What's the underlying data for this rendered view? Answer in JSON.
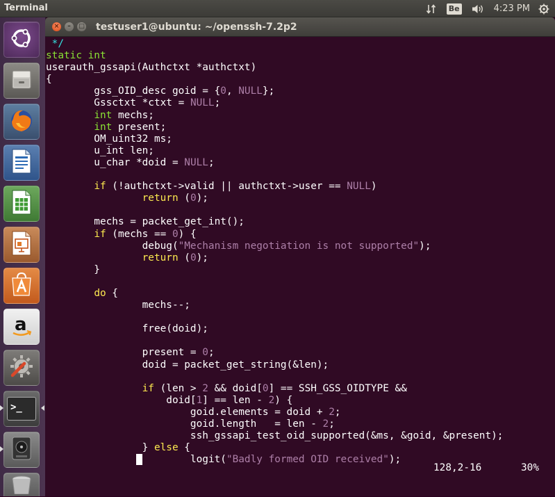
{
  "topbar": {
    "app_title": "Terminal",
    "keyboard_layout": "Be",
    "clock": "4:23 PM",
    "icons": [
      "network-arrows-icon",
      "keyboard-layout-icon",
      "volume-icon",
      "power-gear-icon"
    ]
  },
  "launcher": {
    "items": [
      {
        "name": "ubuntu-dash",
        "icon": "ubuntu-logo-icon"
      },
      {
        "name": "files",
        "icon": "file-cabinet-icon"
      },
      {
        "name": "firefox",
        "icon": "firefox-icon"
      },
      {
        "name": "libreoffice-writer",
        "icon": "writer-document-icon"
      },
      {
        "name": "libreoffice-calc",
        "icon": "calc-spreadsheet-icon"
      },
      {
        "name": "libreoffice-impress",
        "icon": "impress-presentation-icon"
      },
      {
        "name": "ubuntu-software",
        "icon": "software-bag-icon"
      },
      {
        "name": "amazon",
        "icon": "amazon-icon"
      },
      {
        "name": "system-settings",
        "icon": "wrench-gear-icon"
      },
      {
        "name": "terminal",
        "icon": "terminal-prompt-icon",
        "active": true,
        "prompt": ">_"
      },
      {
        "name": "installer-disk",
        "icon": "disk-icon"
      },
      {
        "name": "trash",
        "icon": "trash-icon"
      }
    ]
  },
  "window": {
    "title": "testuser1@ubuntu: ~/openssh-7.2p2",
    "close_glyph": "×",
    "min_glyph": "–",
    "max_glyph": "□"
  },
  "terminal": {
    "colors": {
      "background": "#300a24",
      "comment": "#34e2e2",
      "type": "#8ae234",
      "keyword": "#fce94f",
      "constant": "#ad7fa8",
      "text": "#ffffff"
    },
    "lines": [
      [
        [
          " */",
          "cmt"
        ]
      ],
      [
        [
          "static int",
          "typ"
        ]
      ],
      [
        [
          "userauth_gssapi(Authctxt *authctxt)",
          "id"
        ]
      ],
      [
        [
          "{",
          "plain"
        ]
      ],
      [
        [
          "        gss_OID_desc goid = {",
          "plain"
        ],
        [
          "0",
          "num"
        ],
        [
          ", ",
          "plain"
        ],
        [
          "NULL",
          "num"
        ],
        [
          "};",
          "plain"
        ]
      ],
      [
        [
          "        Gssctxt *ctxt = ",
          "plain"
        ],
        [
          "NULL",
          "num"
        ],
        [
          ";",
          "plain"
        ]
      ],
      [
        [
          "        ",
          "plain"
        ],
        [
          "int",
          "typ"
        ],
        [
          " mechs;",
          "plain"
        ]
      ],
      [
        [
          "        ",
          "plain"
        ],
        [
          "int",
          "typ"
        ],
        [
          " present;",
          "plain"
        ]
      ],
      [
        [
          "        OM_uint32 ms;",
          "plain"
        ]
      ],
      [
        [
          "        u_int len;",
          "plain"
        ]
      ],
      [
        [
          "        u_char *doid = ",
          "plain"
        ],
        [
          "NULL",
          "num"
        ],
        [
          ";",
          "plain"
        ]
      ],
      [
        [
          "",
          "plain"
        ]
      ],
      [
        [
          "        ",
          "plain"
        ],
        [
          "if",
          "kw"
        ],
        [
          " (!authctxt->valid || authctxt->user == ",
          "plain"
        ],
        [
          "NULL",
          "num"
        ],
        [
          ")",
          "plain"
        ]
      ],
      [
        [
          "                ",
          "plain"
        ],
        [
          "return",
          "kw"
        ],
        [
          " (",
          "plain"
        ],
        [
          "0",
          "num"
        ],
        [
          ");",
          "plain"
        ]
      ],
      [
        [
          "",
          "plain"
        ]
      ],
      [
        [
          "        mechs = packet_get_int();",
          "plain"
        ]
      ],
      [
        [
          "        ",
          "plain"
        ],
        [
          "if",
          "kw"
        ],
        [
          " (mechs == ",
          "plain"
        ],
        [
          "0",
          "num"
        ],
        [
          ") {",
          "plain"
        ]
      ],
      [
        [
          "                debug(",
          "plain"
        ],
        [
          "\"Mechanism negotiation is not supported\"",
          "str"
        ],
        [
          ");",
          "plain"
        ]
      ],
      [
        [
          "                ",
          "plain"
        ],
        [
          "return",
          "kw"
        ],
        [
          " (",
          "plain"
        ],
        [
          "0",
          "num"
        ],
        [
          ");",
          "plain"
        ]
      ],
      [
        [
          "        }",
          "plain"
        ]
      ],
      [
        [
          "",
          "plain"
        ]
      ],
      [
        [
          "        ",
          "plain"
        ],
        [
          "do",
          "kw"
        ],
        [
          " {",
          "plain"
        ]
      ],
      [
        [
          "                mechs--;",
          "plain"
        ]
      ],
      [
        [
          "",
          "plain"
        ]
      ],
      [
        [
          "                free(doid);",
          "plain"
        ]
      ],
      [
        [
          "",
          "plain"
        ]
      ],
      [
        [
          "                present = ",
          "plain"
        ],
        [
          "0",
          "num"
        ],
        [
          ";",
          "plain"
        ]
      ],
      [
        [
          "                doid = packet_get_string(&len);",
          "plain"
        ]
      ],
      [
        [
          "",
          "plain"
        ]
      ],
      [
        [
          "                ",
          "plain"
        ],
        [
          "if",
          "kw"
        ],
        [
          " (len > ",
          "plain"
        ],
        [
          "2",
          "num"
        ],
        [
          " && doid[",
          "plain"
        ],
        [
          "0",
          "num"
        ],
        [
          "] == SSH_GSS_OIDTYPE &&",
          "plain"
        ]
      ],
      [
        [
          "                    doid[",
          "plain"
        ],
        [
          "1",
          "num"
        ],
        [
          "] == len - ",
          "plain"
        ],
        [
          "2",
          "num"
        ],
        [
          ") {",
          "plain"
        ]
      ],
      [
        [
          "                        goid.elements = doid + ",
          "plain"
        ],
        [
          "2",
          "num"
        ],
        [
          ";",
          "plain"
        ]
      ],
      [
        [
          "                        goid.length   = len - ",
          "plain"
        ],
        [
          "2",
          "num"
        ],
        [
          ";",
          "plain"
        ]
      ],
      [
        [
          "                        ssh_gssapi_test_oid_supported(&ms, &goid, &present);",
          "plain"
        ]
      ],
      [
        [
          "                } ",
          "plain"
        ],
        [
          "else",
          "kw"
        ],
        [
          " {",
          "plain"
        ]
      ],
      [
        [
          "               ",
          "plain"
        ],
        [
          " ",
          "cursor"
        ],
        [
          "        logit(",
          "plain"
        ],
        [
          "\"Badly formed OID received\"",
          "str"
        ],
        [
          ");",
          "plain"
        ]
      ]
    ],
    "status_position": "128,2-16",
    "status_percent": "30%"
  }
}
